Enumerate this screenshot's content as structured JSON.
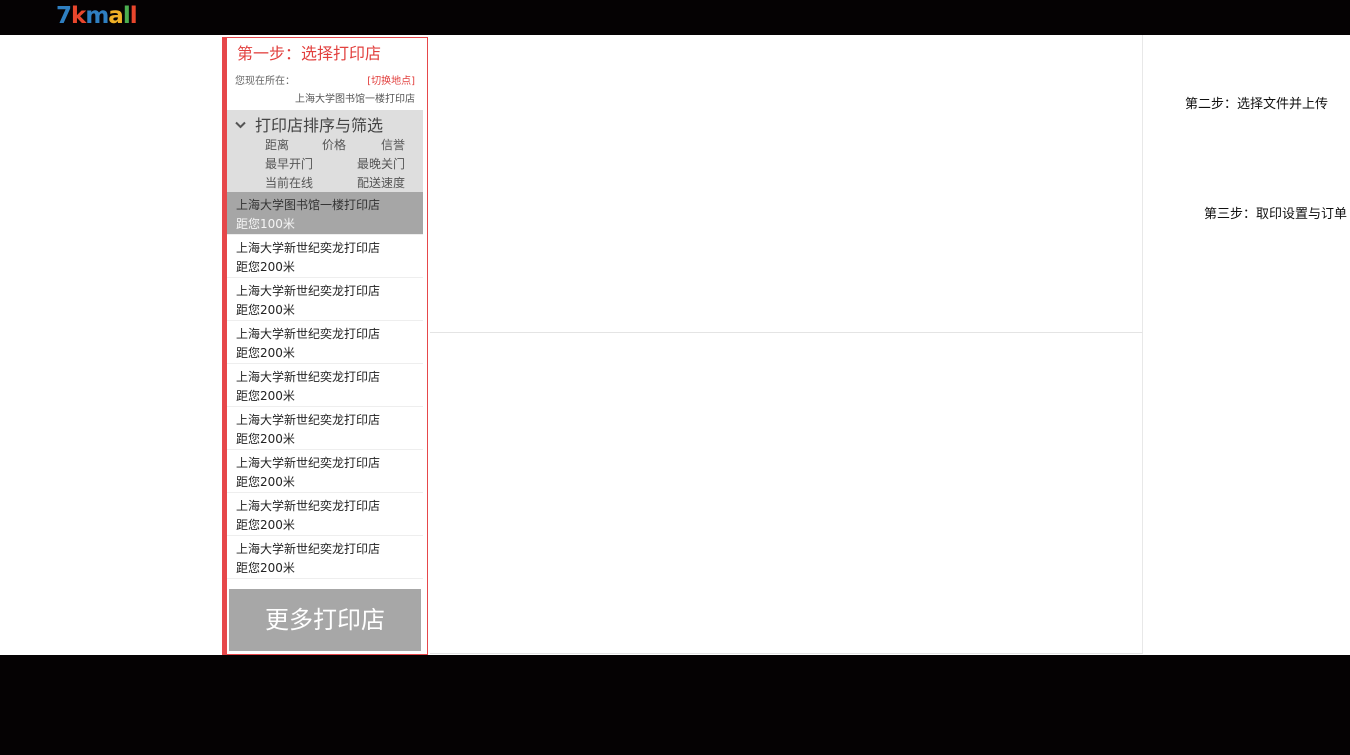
{
  "header": {
    "logo_chars": [
      {
        "char": "7",
        "color": "#2f7fc1"
      },
      {
        "char": "k",
        "color": "#e8462c"
      },
      {
        "char": "m",
        "color": "#2f7fc1"
      },
      {
        "char": "a",
        "color": "#f0b127"
      },
      {
        "char": "l",
        "color": "#4caf50"
      },
      {
        "char": "l",
        "color": "#e8462c"
      }
    ]
  },
  "step1": {
    "title": "第一步：选择打印店",
    "location_label": "您现在所在：",
    "switch_link": "[切换地点]",
    "location_value": "上海大学图书馆一楼打印店",
    "filter": {
      "title": "打印店排序与筛选",
      "icon": "chevron-down-icon",
      "options": [
        "距离",
        "价格",
        "信誉",
        "最早开门",
        "最晚关门",
        "当前在线",
        "配送速度"
      ]
    },
    "stores": [
      {
        "name": "上海大学图书馆一楼打印店",
        "distance": "距您100米",
        "active": true
      },
      {
        "name": "上海大学新世纪奕龙打印店",
        "distance": "距您200米",
        "active": false
      },
      {
        "name": "上海大学新世纪奕龙打印店",
        "distance": "距您200米",
        "active": false
      },
      {
        "name": "上海大学新世纪奕龙打印店",
        "distance": "距您200米",
        "active": false
      },
      {
        "name": "上海大学新世纪奕龙打印店",
        "distance": "距您200米",
        "active": false
      },
      {
        "name": "上海大学新世纪奕龙打印店",
        "distance": "距您200米",
        "active": false
      },
      {
        "name": "上海大学新世纪奕龙打印店",
        "distance": "距您200米",
        "active": false
      },
      {
        "name": "上海大学新世纪奕龙打印店",
        "distance": "距您200米",
        "active": false
      },
      {
        "name": "上海大学新世纪奕龙打印店",
        "distance": "距您200米",
        "active": false
      }
    ],
    "more_button": "更多打印店"
  },
  "step2": {
    "title": "第二步：选择文件并上传"
  },
  "step3": {
    "title": "第三步：取印设置与订单"
  },
  "colors": {
    "accent": "#e2413f",
    "background": "#050203",
    "active_row": "#a6a6a6",
    "filter_bg": "#dedede"
  }
}
